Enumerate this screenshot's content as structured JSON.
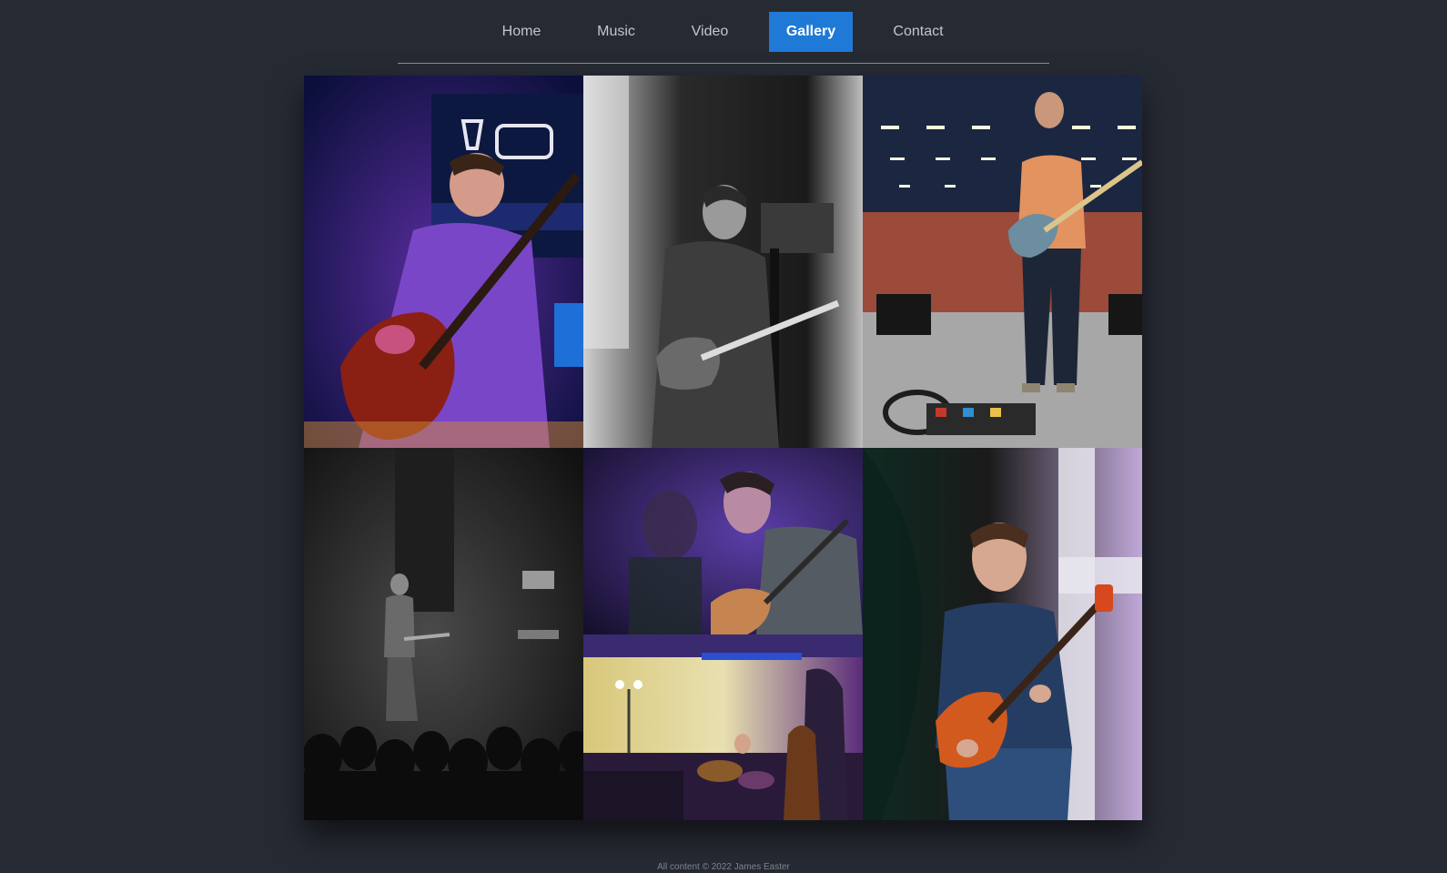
{
  "nav": {
    "items": [
      {
        "label": "Home"
      },
      {
        "label": "Music"
      },
      {
        "label": "Video"
      },
      {
        "label": "Gallery",
        "active": true
      },
      {
        "label": "Contact"
      }
    ],
    "active_color": "#1e7ad6"
  },
  "gallery": {
    "photos": [
      {
        "subject": "guitarist-purple-light"
      },
      {
        "subject": "guitarist-bw-stage"
      },
      {
        "subject": "guitarist-empty-hall"
      },
      {
        "subject": "bw-concert-crowd"
      },
      {
        "subject": "guitarist-close-up-purple"
      },
      {
        "subject": "band-on-stage-purple"
      },
      {
        "subject": "guitarist-blue-shirt"
      }
    ]
  },
  "footer": {
    "text": "All content © 2022 James Easter"
  }
}
